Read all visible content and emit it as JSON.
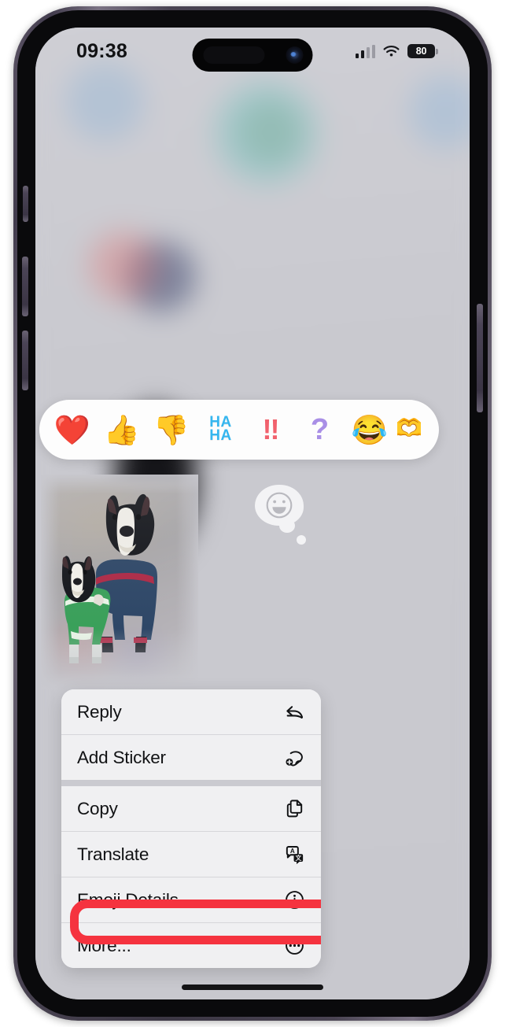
{
  "device": {
    "name": "iPhone",
    "frame_color": "#4a4453",
    "screen_bg": "#c9c9cf"
  },
  "status_bar": {
    "time": "09:38",
    "cellular_icon": "cellular-signal-icon",
    "cellular_bars_filled": 2,
    "cellular_bars_total": 4,
    "wifi_icon": "wifi-icon",
    "battery_percent": "80",
    "battery_icon": "battery-icon"
  },
  "dynamic_island": {
    "speaker_icon": "speaker-slot-icon",
    "camera_icon": "front-camera-icon"
  },
  "reaction_bar": {
    "name": "tapback-reaction-bar",
    "items": [
      {
        "id": "heart",
        "glyph": "❤️",
        "label": "Love",
        "type": "emoji",
        "color": "#ff5fa2"
      },
      {
        "id": "thumbs-up",
        "glyph": "👍",
        "label": "Like",
        "type": "emoji",
        "color": "#f5b83d"
      },
      {
        "id": "thumbs-down",
        "glyph": "👎",
        "label": "Dislike",
        "type": "emoji",
        "color": "#f0952f"
      },
      {
        "id": "haha",
        "glyph": "HA\nHA",
        "label": "Haha",
        "type": "text",
        "color": "#35b6ef"
      },
      {
        "id": "exclamation",
        "glyph": "!!",
        "label": "Emphasize",
        "type": "text",
        "color": "#f1616d"
      },
      {
        "id": "question",
        "glyph": "?",
        "label": "Question",
        "type": "text",
        "color": "#a98fe6"
      },
      {
        "id": "joy",
        "glyph": "😂",
        "label": "Laughing",
        "type": "emoji",
        "color": "#fdd835"
      },
      {
        "id": "partial",
        "glyph": "🫶",
        "label": "More",
        "type": "emoji",
        "color": "#f08b8b"
      }
    ],
    "haha_line1": "HA",
    "haha_line2": "HA"
  },
  "message": {
    "bubble_emoji_icon": "grinning-face-icon",
    "photo_alt": "two dogs wearing pajamas",
    "photo_name": "dog-photo-attachment"
  },
  "context_menu": {
    "name": "message-context-menu",
    "groups": [
      {
        "items": [
          {
            "label": "Reply",
            "icon": "reply-arrow-icon",
            "highlighted": false
          },
          {
            "label": "Add Sticker",
            "icon": "add-sticker-icon",
            "highlighted": false
          }
        ]
      },
      {
        "items": [
          {
            "label": "Copy",
            "icon": "copy-pages-icon",
            "highlighted": false
          },
          {
            "label": "Translate",
            "icon": "translate-icon",
            "highlighted": false
          },
          {
            "label": "Emoji Details...",
            "icon": "info-circle-icon",
            "highlighted": true
          },
          {
            "label": "More...",
            "icon": "more-ellipsis-icon",
            "highlighted": false
          }
        ]
      }
    ]
  },
  "annotation": {
    "name": "red-highlight-box",
    "target_label": "Emoji Details...",
    "color": "#f5333f"
  },
  "home_indicator": {
    "name": "home-indicator"
  }
}
